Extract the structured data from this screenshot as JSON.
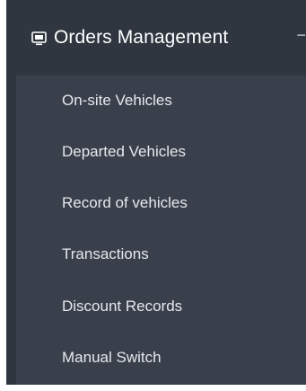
{
  "menu": {
    "header": {
      "icon": "monitor-icon",
      "label": "Orders Management",
      "collapse_symbol": "−"
    },
    "items": [
      {
        "label": "On-site Vehicles"
      },
      {
        "label": "Departed Vehicles"
      },
      {
        "label": "Record of vehicles"
      },
      {
        "label": "Transactions"
      },
      {
        "label": "Discount Records"
      },
      {
        "label": "Manual Switch"
      }
    ]
  },
  "colors": {
    "header_bg": "#2f3640",
    "submenu_bg": "#39404b",
    "text": "#e6e8ec"
  }
}
